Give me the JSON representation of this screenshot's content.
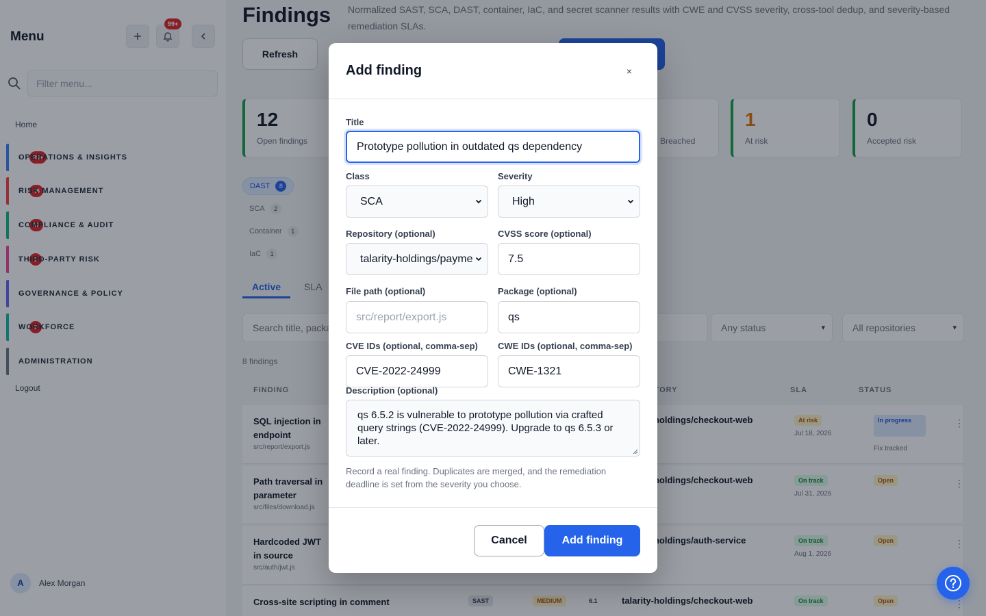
{
  "sidebar": {
    "title": "Menu",
    "notification_count": "99+",
    "search_placeholder": "Filter menu...",
    "home": "Home",
    "groups": [
      {
        "label": "OPERATIONS & INSIGHTS",
        "count": "99+",
        "color": "#3b82f6"
      },
      {
        "label": "RISK MANAGEMENT",
        "count": "16",
        "color": "#ef4444"
      },
      {
        "label": "COMPLIANCE & AUDIT",
        "count": "67",
        "color": "#10b981"
      },
      {
        "label": "THIRD-PARTY RISK",
        "count": "1",
        "color": "#ec4899"
      },
      {
        "label": "GOVERNANCE & POLICY",
        "count": "",
        "color": "#6366f1"
      },
      {
        "label": "WORKFORCE",
        "count": "9",
        "color": "#14b8a6"
      },
      {
        "label": "ADMINISTRATION",
        "count": "",
        "color": "#6b7280"
      }
    ],
    "logout": "Logout",
    "user": {
      "initial": "A",
      "name": "Alex Morgan"
    }
  },
  "page": {
    "title": "Findings",
    "subtitle": "Normalized SAST, SCA, DAST, container, IaC, and secret scanner results with CWE and CVSS severity, cross-tool dedup, and severity-based remediation SLAs.",
    "refresh_label": "Refresh",
    "stats": [
      {
        "value": "12",
        "label": "Open findings",
        "color": "#16a34a"
      },
      {
        "value": "",
        "label": "Breached",
        "color": "#16a34a"
      },
      {
        "value": "1",
        "label": "At risk",
        "color": "#16a34a"
      },
      {
        "value": "0",
        "label": "Accepted risk",
        "color": "#16a34a"
      }
    ],
    "class_chips": [
      {
        "label": "DAST",
        "count": "8"
      },
      {
        "label": "SCA",
        "count": "2"
      },
      {
        "label": "Container",
        "count": "1"
      },
      {
        "label": "IaC",
        "count": "1"
      }
    ],
    "tabs": [
      {
        "label": "Active"
      },
      {
        "label": "SLA"
      }
    ],
    "search_placeholder": "Search title, package...",
    "filters": {
      "status": "Any status",
      "repository": "All repositories"
    },
    "count_text": "8 findings",
    "columns": {
      "finding": "FINDING",
      "repository": "REPOSITORY",
      "sla": "SLA",
      "status": "STATUS"
    },
    "rows": [
      {
        "title": "SQL injection in endpoint",
        "path": "src/report/export.js",
        "repo": "talarity-holdings/checkout-web",
        "sla": "At risk",
        "sla_date": "Jul 18, 2026",
        "status": "In progress",
        "status_sub": "Fix tracked"
      },
      {
        "title": "Path traversal in parameter",
        "path": "src/files/download.js",
        "repo": "talarity-holdings/checkout-web",
        "sla": "On track",
        "sla_date": "Jul 31, 2026",
        "status": "Open",
        "status_sub": ""
      },
      {
        "title": "Hardcoded JWT in source",
        "path": "src/auth/jwt.js",
        "repo": "talarity-holdings/auth-service",
        "sla": "On track",
        "sla_date": "Aug 1, 2026",
        "status": "Open",
        "status_sub": ""
      },
      {
        "title": "Cross-site scripting in comment",
        "path": "",
        "tool": "SAST",
        "severity": "MEDIUM",
        "cvss": "6.1",
        "repo": "talarity-holdings/checkout-web",
        "sla": "On track",
        "sla_date": "",
        "status": "Open",
        "status_sub": ""
      }
    ]
  },
  "modal": {
    "title": "Add finding",
    "close_glyph": "×",
    "fields": {
      "title_label": "Title",
      "title_value": "Prototype pollution in outdated qs dependency",
      "class_label": "Class",
      "class_value": "SCA",
      "severity_label": "Severity",
      "severity_value": "High",
      "repo_label": "Repository (optional)",
      "repo_value": "talarity-holdings/payme",
      "cvss_label": "CVSS score (optional)",
      "cvss_value": "7.5",
      "path_label": "File path (optional)",
      "path_placeholder": "src/report/export.js",
      "package_label": "Package (optional)",
      "package_value": "qs",
      "cve_label": "CVE IDs (optional, comma-sep)",
      "cve_value": "CVE-2022-24999",
      "cwe_label": "CWE IDs (optional, comma-sep)",
      "cwe_value": "CWE-1321",
      "desc_label": "Description (optional)",
      "desc_value": "qs 6.5.2 is vulnerable to prototype pollution via crafted query strings (CVE-2022-24999). Upgrade to qs 6.5.3 or later."
    },
    "hint": "Record a real finding. Duplicates are merged, and the remediation deadline is set from the severity you choose.",
    "cancel_label": "Cancel",
    "submit_label": "Add finding"
  },
  "theme": {
    "accent": "#2563eb",
    "danger": "#dc2626",
    "success": "#16a34a"
  }
}
